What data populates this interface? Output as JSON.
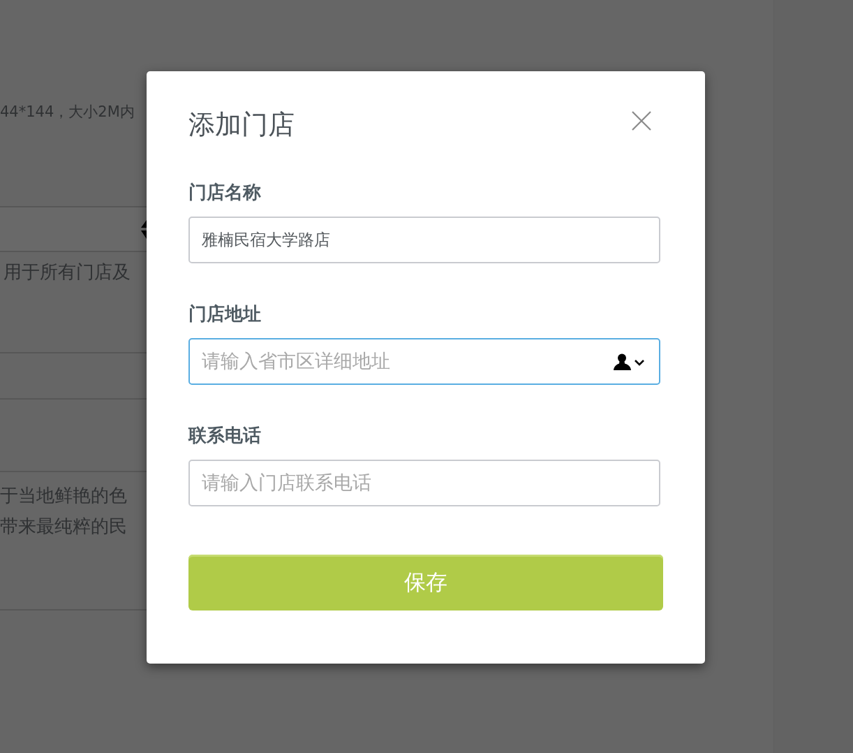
{
  "page": {
    "hint": "44*144，大小2M内",
    "table": {
      "first_row": "用于所有门店及",
      "last_row": [
        "于当地鲜艳的色",
        "带来最纯粹的民"
      ]
    }
  },
  "dialog": {
    "title": "添加门店",
    "fields": [
      {
        "label": "门店名称",
        "kind": "text",
        "value": "雅楠民宿大学路店",
        "focused": false
      },
      {
        "label": "门店地址",
        "kind": "picker",
        "placeholder": "请输入省市区详细地址",
        "focused": true
      },
      {
        "label": "联系电话",
        "kind": "text",
        "placeholder": "请输入门店联系电话",
        "focused": false
      }
    ],
    "save_button": "保存"
  }
}
